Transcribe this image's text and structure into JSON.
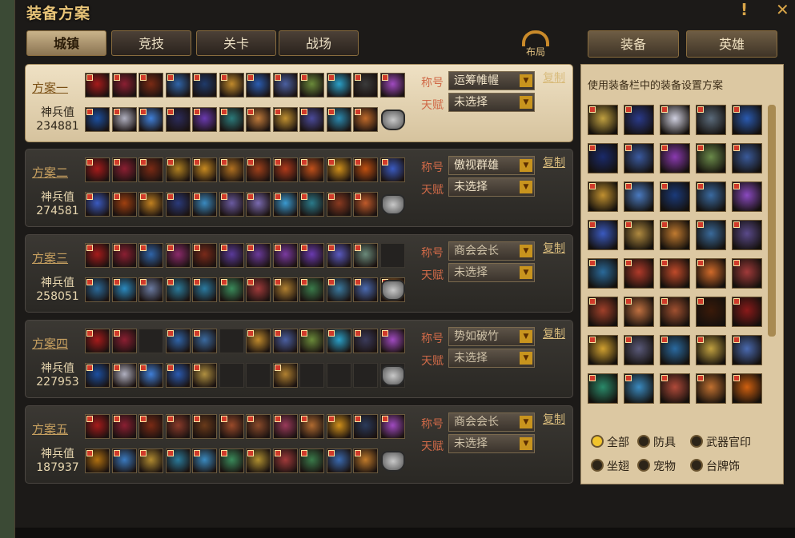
{
  "window": {
    "title": "装备方案",
    "help_icon": "!",
    "close_icon": "✕"
  },
  "tabs": [
    {
      "label": "城镇",
      "active": true
    },
    {
      "label": "竞技",
      "active": false
    },
    {
      "label": "关卡",
      "active": false
    },
    {
      "label": "战场",
      "active": false
    }
  ],
  "layout_button": {
    "label": "布局"
  },
  "right_tabs": [
    {
      "label": "装备",
      "active": true
    },
    {
      "label": "英雄",
      "active": false
    }
  ],
  "hint": "使用装备栏中的装备设置方案",
  "labels": {
    "title": "称号",
    "talent": "天赋",
    "score": "神兵值",
    "copy": "复制"
  },
  "plans": [
    {
      "name": "方案一",
      "score": "234881",
      "title": "运筹帷幄",
      "talent": "未选择",
      "active": true,
      "row1": [
        "#a61b1b",
        "#8b1f32",
        "#7a2a14",
        "#2f64a8",
        "#1f3a6a",
        "#c08a2c",
        "#2a5cb0",
        "#4a5fa0",
        "#6a8a3a",
        "#2aa0c8",
        "#3a3a3a",
        "#a04ac0"
      ],
      "row2": [
        "#1b4fa0",
        "#b0b0c0",
        "#3f7fd8",
        "#2b2b5a",
        "#6a3ab0",
        "#2b7a7a",
        "#c07a3a",
        "#c09030",
        "#4a4a9a",
        "#2a8ab0",
        "#c06a2a"
      ]
    },
    {
      "name": "方案二",
      "score": "274581",
      "title": "傲视群雄",
      "talent": "未选择",
      "active": false,
      "row1": [
        "#a61b1b",
        "#8b1f32",
        "#7a2a14",
        "#b08020",
        "#c88a20",
        "#b07020",
        "#a0401a",
        "#b03a1a",
        "#c0501a",
        "#d0901a",
        "#c05010",
        "#3a5ac0"
      ],
      "row2": [
        "#3a5ac0",
        "#a04010",
        "#c08020",
        "#2a3a7a",
        "#3a8ac0",
        "#6a5aa0",
        "#7a6ab0",
        "#3a9ad0",
        "#2a7a8a",
        "#8a3a20",
        "#c05a2a"
      ]
    },
    {
      "name": "方案三",
      "score": "258051",
      "title": "商会会长",
      "talent": "未选择",
      "active": false,
      "dim": true,
      "row1": [
        "#a61b1b",
        "#8b1f32",
        "#2f64a8",
        "#8a2a6a",
        "#7a2a1a",
        "#5a3a9a",
        "#6a3a9a",
        "#7a3aa0",
        "#6a3ab0",
        "#5a5ac0",
        "#6a8a7a",
        ""
      ],
      "row2": [
        "#2a6a9a",
        "#2a8ac0",
        "#6a7aa0",
        "#2a7a9a",
        "#2a7aa0",
        "#3a8a5a",
        "#a03a3a",
        "#b08030",
        "#3a7a4a",
        "#3a7aa0",
        "#4a6ab0",
        "#c07a2a"
      ]
    },
    {
      "name": "方案四",
      "score": "227953",
      "title": "势如破竹",
      "talent": "未选择",
      "active": false,
      "dim": true,
      "row1": [
        "#a61b1b",
        "#8b1f32",
        "",
        "#2f64a8",
        "#3a6aa0",
        "",
        "#c08a2c",
        "#4a5fa0",
        "#6a8a3a",
        "#2aa0c8",
        "#3a3a5a",
        "#a04ac0"
      ],
      "row2": [
        "#1b4fa0",
        "#b0b0c0",
        "#3f7fd8",
        "#2a5ab0",
        "#b09040",
        "",
        "",
        "#b08030",
        "",
        "",
        "",
        ""
      ]
    },
    {
      "name": "方案五",
      "score": "187937",
      "title": "商会会长",
      "talent": "未选择",
      "active": false,
      "dim": true,
      "row1": [
        "#a61b1b",
        "#8b1f32",
        "#7a2a14",
        "#8a3a2a",
        "#6a3a1a",
        "#9a4a2a",
        "#8a4a2a",
        "#9a3a5a",
        "#b06a30",
        "#d0901a",
        "#2a3a5a",
        "#a04ac0"
      ],
      "row2": [
        "#b07010",
        "#3a7ac0",
        "#b08a30",
        "#2a7a9a",
        "#3a8ac0",
        "#3a8a5a",
        "#b09030",
        "#a03a3a",
        "#3a7a4a",
        "#3a6ab0",
        "#c07a2a"
      ]
    }
  ],
  "inventory": [
    "#c0a040",
    "#2a3a8a",
    "#d0d0e0",
    "#5a6a7a",
    "#2a5ab0",
    "#1a2a6a",
    "#3a5aa0",
    "#8a3ab0",
    "#6a8a4a",
    "#3a5a9a",
    "#c09030",
    "#4a7ac0",
    "#1a3a7a",
    "#3a6aa0",
    "#8a4ac0",
    "#3a5ac0",
    "#b08a40",
    "#c07a30",
    "#3a6a9a",
    "#5a4a8a",
    "#2a6a9a",
    "#b03a2a",
    "#c04a2a",
    "#d06a2a",
    "#a03a3a",
    "#a0402a",
    "#c07040",
    "#a05030",
    "#3a1a0a",
    "#8a1a1a",
    "#d0a030",
    "#5a5a7a",
    "#2a6aa0",
    "#c0a040",
    "#4a6ab0",
    "#2a8a6a",
    "#3a8ac0",
    "#b04a3a",
    "#c07030",
    "#d06010"
  ],
  "filters": [
    {
      "label": "全部",
      "on": true
    },
    {
      "label": "防具",
      "on": false
    },
    {
      "label": "武器官印",
      "on": false
    },
    {
      "label": "坐翅",
      "on": false
    },
    {
      "label": "宠物",
      "on": false
    },
    {
      "label": "台牌饰",
      "on": false
    }
  ]
}
